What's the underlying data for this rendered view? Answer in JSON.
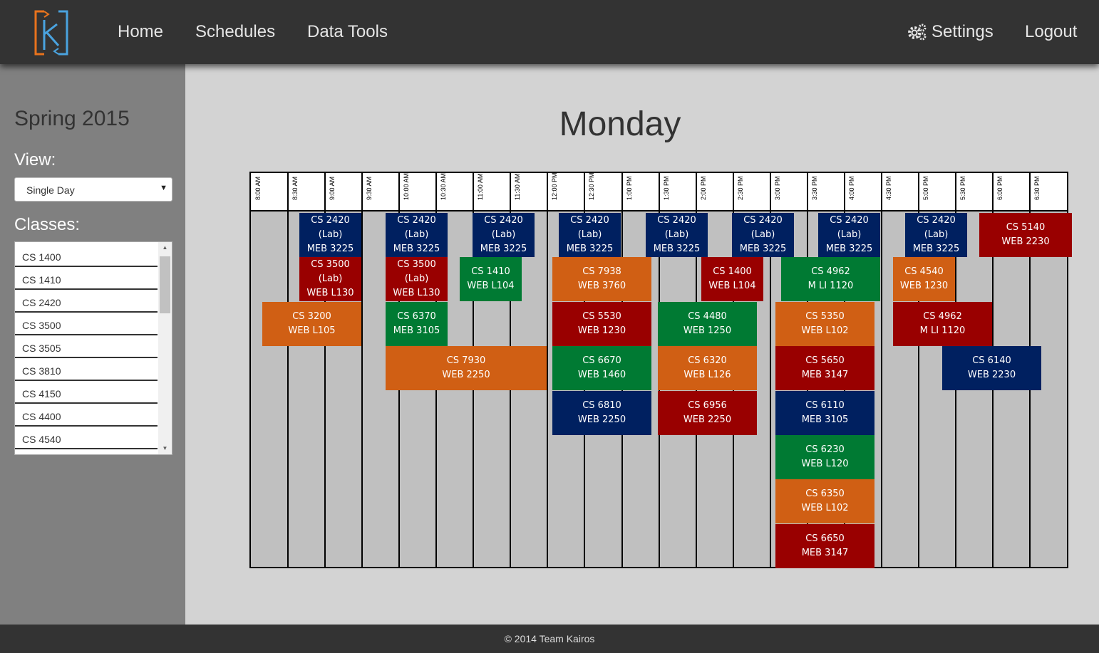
{
  "nav": {
    "home": "Home",
    "schedules": "Schedules",
    "data_tools": "Data Tools",
    "settings": "Settings",
    "logout": "Logout"
  },
  "sidebar": {
    "term": "Spring 2015",
    "view_label": "View:",
    "view_selected": "Single Day",
    "classes_label": "Classes:",
    "classes": [
      "CS 1400",
      "CS 1410",
      "CS 2420",
      "CS 3500",
      "CS 3505",
      "CS 3810",
      "CS 4150",
      "CS 4400",
      "CS 4540"
    ]
  },
  "schedule": {
    "day": "Monday",
    "times": [
      "8:00 AM",
      "8:30 AM",
      "9:00 AM",
      "9:30 AM",
      "10:00 AM",
      "10:30 AM",
      "11:00 AM",
      "11:30 AM",
      "12:00 PM",
      "12:30 PM",
      "1:00 PM",
      "1:30 PM",
      "2:00 PM",
      "2:30 PM",
      "3:00 PM",
      "3:30 PM",
      "4:00 PM",
      "4:30 PM",
      "5:00 PM",
      "5:30 PM",
      "6:00 PM",
      "6:30 PM"
    ],
    "colors": {
      "navy": "#002060",
      "red": "#990000",
      "green": "#007a33",
      "orange": "#d05f14"
    },
    "events": [
      {
        "lines": [
          "CS 2420",
          "(Lab)",
          "MEB 3225"
        ],
        "color": "navy",
        "start": "8:35 AM",
        "end": "9:25 AM",
        "row": 0
      },
      {
        "lines": [
          "CS 2420",
          "(Lab)",
          "MEB 3225"
        ],
        "color": "navy",
        "start": "9:45 AM",
        "end": "10:35 AM",
        "row": 0
      },
      {
        "lines": [
          "CS 2420",
          "(Lab)",
          "MEB 3225"
        ],
        "color": "navy",
        "start": "10:55 AM",
        "end": "11:45 AM",
        "row": 0
      },
      {
        "lines": [
          "CS 2420",
          "(Lab)",
          "MEB 3225"
        ],
        "color": "navy",
        "start": "12:05 PM",
        "end": "12:55 PM",
        "row": 0
      },
      {
        "lines": [
          "CS 2420",
          "(Lab)",
          "MEB 3225"
        ],
        "color": "navy",
        "start": "1:15 PM",
        "end": "2:05 PM",
        "row": 0
      },
      {
        "lines": [
          "CS 2420",
          "(Lab)",
          "MEB 3225"
        ],
        "color": "navy",
        "start": "2:25 PM",
        "end": "3:15 PM",
        "row": 0
      },
      {
        "lines": [
          "CS 2420",
          "(Lab)",
          "MEB 3225"
        ],
        "color": "navy",
        "start": "3:35 PM",
        "end": "4:25 PM",
        "row": 0
      },
      {
        "lines": [
          "CS 2420",
          "(Lab)",
          "MEB 3225"
        ],
        "color": "navy",
        "start": "4:45 PM",
        "end": "5:35 PM",
        "row": 0
      },
      {
        "lines": [
          "CS 5140",
          "WEB 2230"
        ],
        "color": "red",
        "start": "5:45 PM",
        "end": "7:00 PM",
        "row": 0
      },
      {
        "lines": [
          "CS 3500",
          "(Lab)",
          "WEB L130"
        ],
        "color": "red",
        "start": "8:35 AM",
        "end": "9:25 AM",
        "row": 1
      },
      {
        "lines": [
          "CS 3500",
          "(Lab)",
          "WEB L130"
        ],
        "color": "red",
        "start": "9:45 AM",
        "end": "10:35 AM",
        "row": 1
      },
      {
        "lines": [
          "CS 1410",
          "WEB L104"
        ],
        "color": "green",
        "start": "10:45 AM",
        "end": "11:35 AM",
        "row": 1
      },
      {
        "lines": [
          "CS 7938",
          "WEB 3760"
        ],
        "color": "orange",
        "start": "12:00 PM",
        "end": "1:20 PM",
        "row": 1
      },
      {
        "lines": [
          "CS 1400",
          "WEB L104"
        ],
        "color": "red",
        "start": "2:00 PM",
        "end": "2:50 PM",
        "row": 1
      },
      {
        "lines": [
          "CS 4962",
          "M LI 1120"
        ],
        "color": "green",
        "start": "3:05 PM",
        "end": "4:25 PM",
        "row": 1
      },
      {
        "lines": [
          "CS 4540",
          "WEB 1230"
        ],
        "color": "orange",
        "start": "4:35 PM",
        "end": "5:25 PM",
        "row": 1
      },
      {
        "lines": [
          "CS 3200",
          "WEB L105"
        ],
        "color": "orange",
        "start": "8:05 AM",
        "end": "9:25 AM",
        "row": 2
      },
      {
        "lines": [
          "CS 6370",
          "MEB 3105"
        ],
        "color": "green",
        "start": "9:45 AM",
        "end": "10:35 AM",
        "row": 2
      },
      {
        "lines": [
          "CS 5530",
          "WEB 1230"
        ],
        "color": "red",
        "start": "12:00 PM",
        "end": "1:20 PM",
        "row": 2
      },
      {
        "lines": [
          "CS 4480",
          "WEB 1250"
        ],
        "color": "green",
        "start": "1:25 PM",
        "end": "2:45 PM",
        "row": 2
      },
      {
        "lines": [
          "CS 5350",
          "WEB L102"
        ],
        "color": "orange",
        "start": "3:00 PM",
        "end": "4:20 PM",
        "row": 2
      },
      {
        "lines": [
          "CS 4962",
          "M LI 1120"
        ],
        "color": "red",
        "start": "4:35 PM",
        "end": "5:55 PM",
        "row": 2
      },
      {
        "lines": [
          "CS 7930",
          "WEB 2250"
        ],
        "color": "orange",
        "start": "9:45 AM",
        "end": "11:55 AM",
        "row": 3
      },
      {
        "lines": [
          "CS 6670",
          "WEB 1460"
        ],
        "color": "green",
        "start": "12:00 PM",
        "end": "1:20 PM",
        "row": 3
      },
      {
        "lines": [
          "CS 6320",
          "WEB L126"
        ],
        "color": "orange",
        "start": "1:25 PM",
        "end": "2:45 PM",
        "row": 3
      },
      {
        "lines": [
          "CS 5650",
          "MEB 3147"
        ],
        "color": "red",
        "start": "3:00 PM",
        "end": "4:20 PM",
        "row": 3
      },
      {
        "lines": [
          "CS 6140",
          "WEB 2230"
        ],
        "color": "navy",
        "start": "5:15 PM",
        "end": "6:35 PM",
        "row": 3
      },
      {
        "lines": [
          "CS 6810",
          "WEB 2250"
        ],
        "color": "navy",
        "start": "12:00 PM",
        "end": "1:20 PM",
        "row": 4
      },
      {
        "lines": [
          "CS 6956",
          "WEB 2250"
        ],
        "color": "red",
        "start": "1:25 PM",
        "end": "2:45 PM",
        "row": 4
      },
      {
        "lines": [
          "CS 6110",
          "MEB 3105"
        ],
        "color": "navy",
        "start": "3:00 PM",
        "end": "4:20 PM",
        "row": 4
      },
      {
        "lines": [
          "CS 6230",
          "WEB L120"
        ],
        "color": "green",
        "start": "3:00 PM",
        "end": "4:20 PM",
        "row": 5
      },
      {
        "lines": [
          "CS 6350",
          "WEB L102"
        ],
        "color": "orange",
        "start": "3:00 PM",
        "end": "4:20 PM",
        "row": 6
      },
      {
        "lines": [
          "CS 6650",
          "MEB 3147"
        ],
        "color": "red",
        "start": "3:00 PM",
        "end": "4:20 PM",
        "row": 7
      }
    ]
  },
  "footer": {
    "text": "© 2014 Team Kairos"
  }
}
